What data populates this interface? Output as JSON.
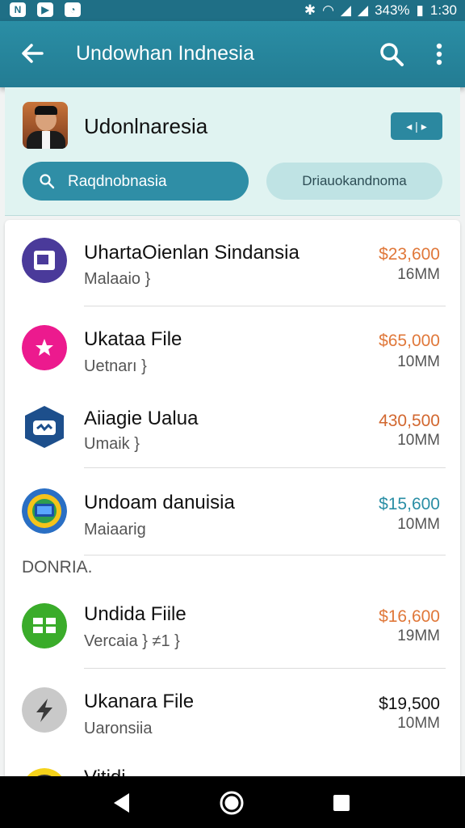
{
  "status_bar": {
    "battery": "343%",
    "time": "1:30"
  },
  "app_bar": {
    "title": "Undowhan Indnesia"
  },
  "account": {
    "name": "Udonlnaresia",
    "button_label": "◂ | ▸"
  },
  "filters": {
    "primary": "Raqdnobnasia",
    "secondary": "Driauokandnoma"
  },
  "section_label": "DONRIA.",
  "items": [
    {
      "name": "UhartaOienlan Sindansia",
      "sub": "Malaaio }",
      "amount": "$23,600",
      "size": "16MM",
      "amount_color": "#e0783a",
      "icon": "document-icon"
    },
    {
      "name": "Ukataa File",
      "sub": "Uetnarı }",
      "amount": "$65,000",
      "size": "10MM",
      "amount_color": "#e0783a",
      "icon": "star-icon"
    },
    {
      "name": "Aiiagie Ualua",
      "sub": "Umaik }",
      "amount": "430,500",
      "size": "10MM",
      "amount_color": "#d2672f",
      "icon": "shield-icon"
    },
    {
      "name": "Undoam danuisia",
      "sub": "Maiaarig",
      "amount": "$15,600",
      "size": "10MM",
      "amount_color": "#2a8ea5",
      "icon": "laptop-icon"
    },
    {
      "name": "Undida Fiile",
      "sub": "Vercaia }    ≠1 }",
      "amount": "$16,600",
      "size": "19MM",
      "amount_color": "#e0783a",
      "icon": "grid-icon"
    },
    {
      "name": "Ukanara File",
      "sub": "Uaronsiia",
      "amount": "$19,500",
      "size": "10MM",
      "amount_color": "#111111",
      "icon": "lightning-icon"
    },
    {
      "name": "Vitidi",
      "sub": "",
      "amount": "",
      "size": "",
      "amount_color": "#e0783a",
      "icon": "app-icon"
    }
  ]
}
